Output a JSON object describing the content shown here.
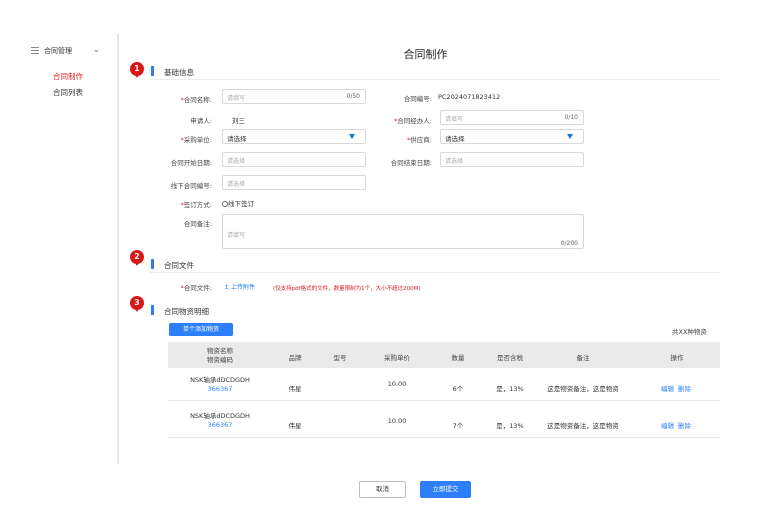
{
  "sidebar": {
    "title": "合同管理",
    "items": [
      {
        "label": "合同制作",
        "active": true
      },
      {
        "label": "合同列表",
        "active": false
      }
    ]
  },
  "page_title": "合同制作",
  "badges": [
    "1",
    "2",
    "3"
  ],
  "sections": {
    "basic": "基础信息",
    "files": "合同文件",
    "materials": "合同物资明细"
  },
  "form": {
    "contract_name": {
      "label": "合同名称:",
      "placeholder": "请填写",
      "count": "0/50"
    },
    "contract_no": {
      "label": "合同编号:",
      "value": "PC2024071823412"
    },
    "applicant": {
      "label": "申请人:",
      "value": "刘三"
    },
    "handler": {
      "label": "合同经办人:",
      "placeholder": "请填写",
      "count": "0/10"
    },
    "purchaser": {
      "label": "采购单位:",
      "value": "请选择"
    },
    "supplier": {
      "label": "供应商:",
      "value": "请选择"
    },
    "start_date": {
      "label": "合同开始日期:",
      "placeholder": "请选择"
    },
    "end_date": {
      "label": "合同结束日期:",
      "placeholder": "请选择"
    },
    "offline_no": {
      "label": "线下合同编号:",
      "placeholder": "请选择"
    },
    "sign_method": {
      "label": "签订方式:",
      "option": "线下签订"
    },
    "remark": {
      "label": "合同备注:",
      "placeholder": "请填写",
      "count": "0/200"
    }
  },
  "files": {
    "label": "合同文件:",
    "upload": "上传附件",
    "hint": "(仅支持pdf格式的文件，数量限制为1个，大小不超过200M)"
  },
  "materials": {
    "add_button": "单个添加物资",
    "total": "共XX种物资",
    "headers": {
      "name_line1": "物资名称",
      "name_line2": "物资编码",
      "brand": "品牌",
      "model": "型号",
      "price": "采购单价",
      "qty": "数量",
      "tax": "是否含税",
      "remark": "备注",
      "ops": "操作"
    },
    "rows": [
      {
        "name": "NSK轴承dDCDGDH",
        "code": "366367",
        "brand": "伟星",
        "model": "",
        "price": "10.00",
        "qty": "6个",
        "tax": "是，13%",
        "remark": "这是物资备注，这是物资",
        "edit": "编辑",
        "delete": "删除"
      },
      {
        "name": "NSK轴承dDCDGDH",
        "code": "366367",
        "brand": "伟星",
        "model": "",
        "price": "10.00",
        "qty": "7个",
        "tax": "是，13%",
        "remark": "这是物资备注，这是物资",
        "edit": "编辑",
        "delete": "删除"
      }
    ]
  },
  "footer": {
    "cancel": "取消",
    "submit": "立即提交"
  },
  "colors": {
    "accent": "#2d7ff9",
    "badge": "#d71818",
    "required": "#e02020"
  }
}
